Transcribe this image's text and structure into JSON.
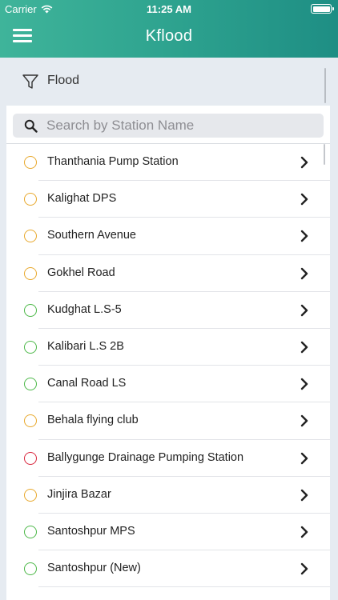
{
  "status_bar": {
    "carrier": "Carrier",
    "time": "11:25 AM"
  },
  "nav": {
    "title": "Kflood",
    "menu_icon": "hamburger-menu-icon"
  },
  "filter": {
    "label": "Flood",
    "icon": "funnel-icon"
  },
  "search": {
    "placeholder": "Search by Station Name",
    "value": "",
    "icon": "search-icon"
  },
  "colors": {
    "header_start": "#3fb49a",
    "header_end": "#1e8e84",
    "status_warning": "#e8a82c",
    "status_normal": "#4cb848",
    "status_danger": "#d9263d"
  },
  "stations": [
    {
      "name": "Thanthania Pump Station",
      "status": "warning"
    },
    {
      "name": "Kalighat DPS",
      "status": "warning"
    },
    {
      "name": "Southern Avenue",
      "status": "warning"
    },
    {
      "name": "Gokhel  Road",
      "status": "warning"
    },
    {
      "name": "Kudghat L.S-5",
      "status": "normal"
    },
    {
      "name": "Kalibari L.S 2B",
      "status": "normal"
    },
    {
      "name": "Canal Road LS",
      "status": "normal"
    },
    {
      "name": "Behala flying club",
      "status": "warning"
    },
    {
      "name": "Ballygunge Drainage Pumping Station",
      "status": "danger"
    },
    {
      "name": "Jinjira Bazar",
      "status": "warning"
    },
    {
      "name": "Santoshpur MPS",
      "status": "normal"
    },
    {
      "name": "Santoshpur (New)",
      "status": "normal"
    }
  ]
}
